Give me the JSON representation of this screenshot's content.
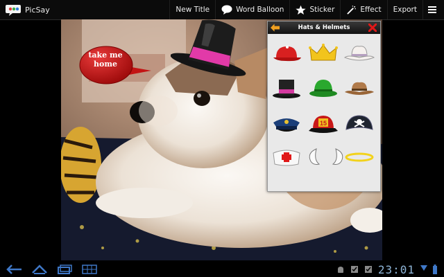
{
  "app": {
    "name": "PicSay",
    "logo_text": "PicSay"
  },
  "toolbar": {
    "new_title": "New Title",
    "word_balloon": "Word Balloon",
    "sticker": "Sticker",
    "effect": "Effect",
    "export": "Export"
  },
  "canvas": {
    "balloon_text": "take me home",
    "hat_sticker": "top-hat-pink-band"
  },
  "sticker_panel": {
    "title": "Hats & Helmets",
    "items": [
      "red-cap-icon",
      "gold-crown-icon",
      "white-cowboy-hat-icon",
      "black-top-hat-icon",
      "green-bowler-hat-icon",
      "brown-cowboy-hat-icon",
      "police-cap-icon",
      "fire-helmet-icon",
      "pirate-hat-icon",
      "nurse-cap-icon",
      "left-ear-icon",
      "right-ear-icon",
      "halo-icon"
    ],
    "fire_helmet_number": "15"
  },
  "system_bar": {
    "time": "23:01"
  },
  "colors": {
    "accent": "#e0a020",
    "close": "#d01010",
    "clock": "#8fb6d8"
  }
}
